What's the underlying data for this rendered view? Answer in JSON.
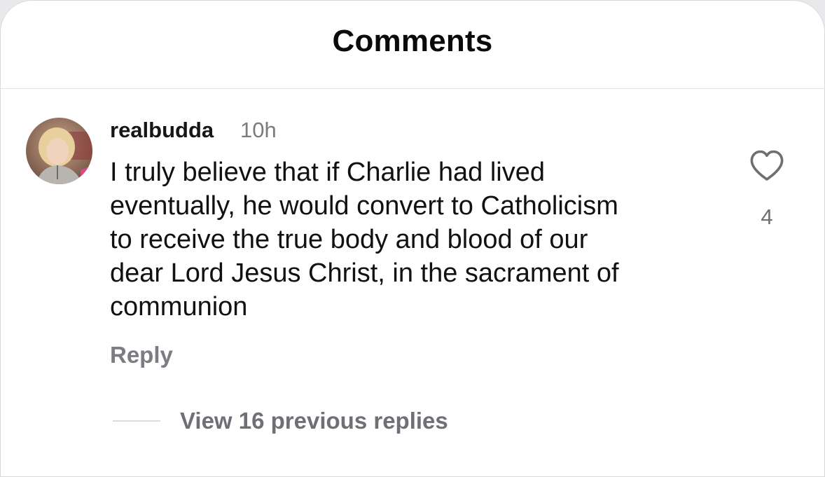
{
  "header": {
    "title": "Comments"
  },
  "comment": {
    "username": "realbudda",
    "time": "10h",
    "text_lines": [
      "I truly believe that if Charlie had lived",
      "eventually, he would convert to Catholicism",
      "to receive the true body and blood of our",
      "dear Lord Jesus Christ, in the sacrament of",
      "communion"
    ],
    "like_icon": "heart-outline-icon",
    "like_count": "4",
    "reply_label": "Reply",
    "view_replies_label": "View 16 previous replies"
  },
  "colors": {
    "text_primary": "#111111",
    "text_secondary": "#7b7b80",
    "divider": "#e4e4e6",
    "background": "#ffffff"
  }
}
